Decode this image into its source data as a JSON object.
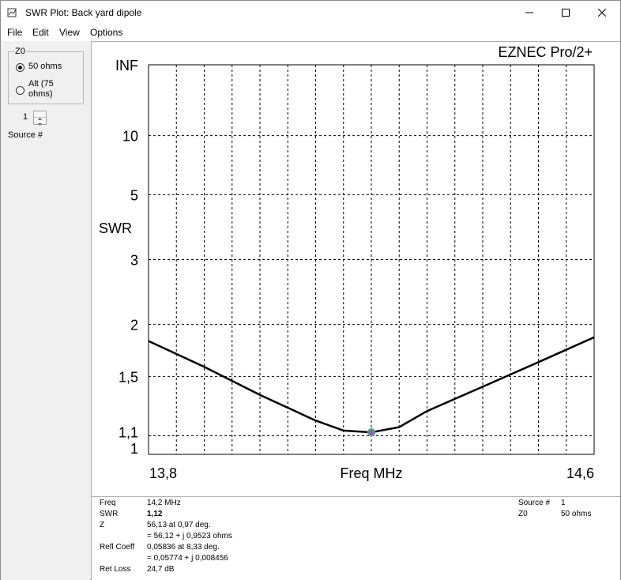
{
  "window": {
    "title": "SWR Plot: Back yard dipole"
  },
  "menu": {
    "file": "File",
    "edit": "Edit",
    "view": "View",
    "options": "Options"
  },
  "left_panel": {
    "group_label": "Z0",
    "option_50": "50 ohms",
    "option_alt": "Alt (75 ohms)",
    "selected": "50 ohms",
    "source_value": "1",
    "source_label": "Source #"
  },
  "plot": {
    "brand": "EZNEC Pro/2+",
    "colors": {
      "curve": "#000000",
      "marker_fill": "#9b59b6",
      "marker_ring": "#2ecc71"
    }
  },
  "chart_data": {
    "type": "line",
    "title": "",
    "xlabel": "Freq MHz",
    "ylabel": "SWR",
    "xlim": [
      13.8,
      14.6
    ],
    "ylim": [
      1,
      "INF"
    ],
    "y_scale": "reflection (|rho|)",
    "x_tick_labels": [
      "13,8",
      "14,6"
    ],
    "y_tick_labels": [
      "INF",
      "10",
      "5",
      "3",
      "2",
      "1,5",
      "1,1",
      "1"
    ],
    "y_tick_values": [
      null,
      10,
      5,
      3,
      2,
      1.5,
      1.1,
      1
    ],
    "grid": true,
    "series": [
      {
        "x": [
          13.8,
          13.9,
          14.0,
          14.1,
          14.15,
          14.2,
          14.25,
          14.3,
          14.4,
          14.5,
          14.6
        ],
        "values": [
          1.82,
          1.58,
          1.36,
          1.19,
          1.13,
          1.12,
          1.15,
          1.25,
          1.42,
          1.62,
          1.86
        ]
      }
    ],
    "marker": {
      "x": 14.2,
      "y": 1.12
    }
  },
  "info": {
    "freq_label": "Freq",
    "freq_value": "14,2 MHz",
    "swr_label": "SWR",
    "swr_value": "1,12",
    "z_label": "Z",
    "z_polar": "56,13 at 0,97 deg.",
    "z_rect": "= 56,12 + j 0,9523 ohms",
    "refl_label": "Refl Coeff",
    "refl_polar": "0,05836 at 8,33 deg.",
    "refl_rect": "= 0,05774 + j 0,008456",
    "retloss_label": "Ret Loss",
    "retloss_value": "24,7 dB",
    "source_label": "Source #",
    "source_value": "1",
    "z0_label": "Z0",
    "z0_value": "50 ohms"
  }
}
